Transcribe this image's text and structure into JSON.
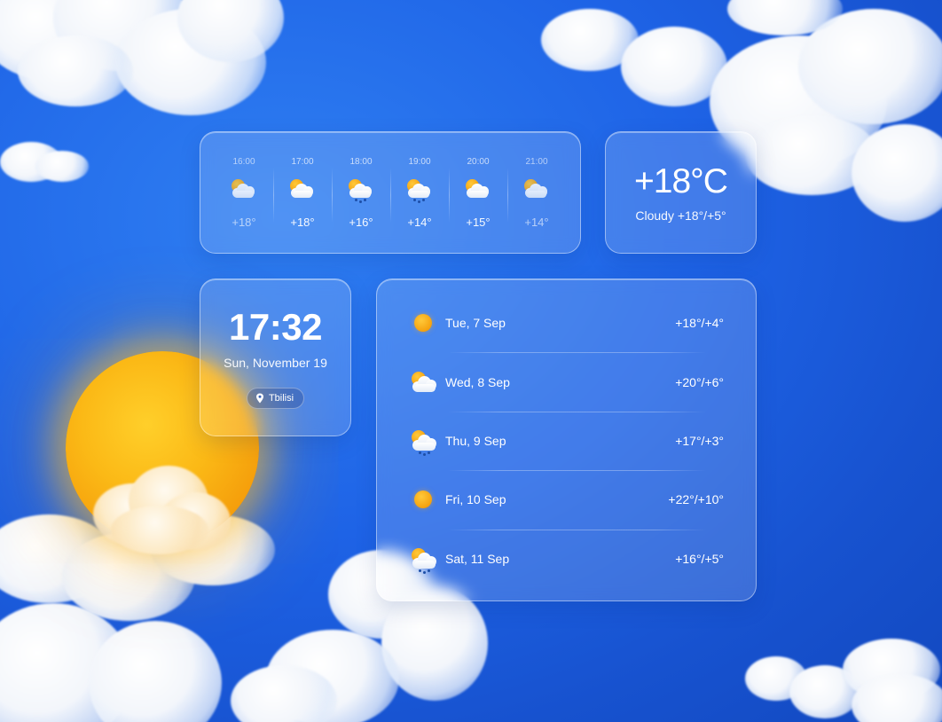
{
  "hourly": [
    {
      "time": "16:00",
      "icon": "partly-cloudy-icon",
      "temp": "+18°",
      "dim": true
    },
    {
      "time": "17:00",
      "icon": "partly-cloudy-icon",
      "temp": "+18°",
      "dim": false
    },
    {
      "time": "18:00",
      "icon": "partly-cloudy-rain-icon",
      "temp": "+16°",
      "dim": false
    },
    {
      "time": "19:00",
      "icon": "partly-cloudy-rain-icon",
      "temp": "+14°",
      "dim": false
    },
    {
      "time": "20:00",
      "icon": "partly-cloudy-icon",
      "temp": "+15°",
      "dim": false
    },
    {
      "time": "21:00",
      "icon": "partly-cloudy-icon",
      "temp": "+14°",
      "dim": true
    }
  ],
  "current": {
    "temp": "+18°C",
    "condition": "Cloudy +18°/+5°"
  },
  "clock": {
    "time": "17:32",
    "date": "Sun, November 19",
    "location": "Tbilisi",
    "location_icon": "map-pin-icon"
  },
  "daily": [
    {
      "label": "Tue, 7 Sep",
      "icon": "sun-icon",
      "temp": "+18°/+4°"
    },
    {
      "label": "Wed, 8 Sep",
      "icon": "partly-cloudy-icon",
      "temp": "+20°/+6°"
    },
    {
      "label": "Thu, 9 Sep",
      "icon": "partly-cloudy-rain-icon",
      "temp": "+17°/+3°"
    },
    {
      "label": "Fri, 10 Sep",
      "icon": "sun-icon",
      "temp": "+22°/+10°"
    },
    {
      "label": "Sat, 11 Sep",
      "icon": "partly-cloudy-rain-icon",
      "temp": "+16°/+5°"
    }
  ],
  "colors": {
    "sky": "#1e63e6",
    "sun": "#f5a20f"
  }
}
